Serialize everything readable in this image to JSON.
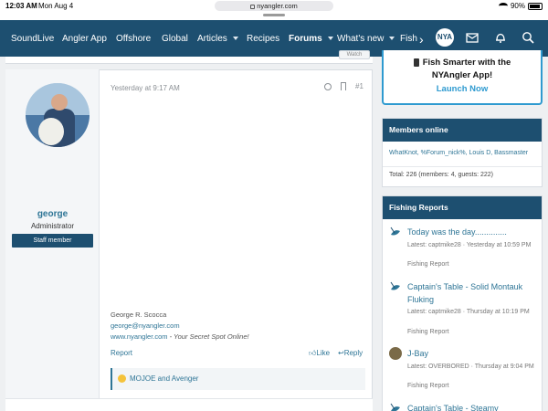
{
  "status_bar": {
    "time": "12:03 AM",
    "date": "Mon Aug 4",
    "url": "nyangler.com",
    "battery": "90%"
  },
  "nav": {
    "items": [
      {
        "label": "SoundLive",
        "caret": false,
        "bold": false
      },
      {
        "label": "Angler App",
        "caret": false,
        "bold": false
      },
      {
        "label": "Offshore",
        "caret": false,
        "bold": false
      },
      {
        "label": "Global",
        "caret": false,
        "bold": false
      },
      {
        "label": "Articles",
        "caret": true,
        "bold": false
      },
      {
        "label": "Recipes",
        "caret": false,
        "bold": false
      },
      {
        "label": "Forums",
        "caret": true,
        "bold": true
      },
      {
        "label": "What's new",
        "caret": true,
        "bold": false
      },
      {
        "label": "Fish",
        "caret": false,
        "bold": false
      }
    ],
    "logo_text": "NYA",
    "icons": [
      "inbox-icon",
      "bell-icon",
      "search-icon"
    ]
  },
  "post": {
    "watch_label": "Watch",
    "author_name": "george",
    "author_role": "Administrator",
    "author_badge": "Staff member",
    "timestamp": "Yesterday at 9:17 AM",
    "post_number": "#1",
    "signature": {
      "name": "George R. Scocca",
      "email": "george@nyangler.com",
      "site": "www.nyangler.com",
      "tagline": " - Your Secret Spot Online!"
    },
    "report_label": "Report",
    "like_label": "Like",
    "reply_label": "Reply",
    "reactions_text": "MOJOE and Avenger"
  },
  "sidebar": {
    "promo": {
      "line1": "Fish Smarter with the",
      "line2": "NYAngler App!",
      "line3": "Launch Now"
    },
    "members_online": {
      "title": "Members online",
      "list": "WhatKnot, %Forum_nick%, Louis D, Bassmaster",
      "total": "Total: 226 (members: 4, guests: 222)"
    },
    "fishing_reports": {
      "title": "Fishing Reports",
      "items": [
        {
          "title": "Today was the day..............",
          "meta": "Latest: captmike28 · Yesterday at 10:59 PM",
          "forum": "Fishing Report"
        },
        {
          "title": "Captain's Table - Solid Montauk Fluking",
          "meta": "Latest: captmike28 · Thursday at 10:19 PM",
          "forum": "Fishing Report"
        },
        {
          "title": "J-Bay",
          "meta": "Latest: OVERBORED · Thursday at 9:04 PM",
          "forum": "Fishing Report"
        },
        {
          "title": "Captain's Table - Steamy",
          "meta": "",
          "forum": ""
        }
      ]
    }
  },
  "colors": {
    "nav_bg": "#1d4f70",
    "link": "#2e7596",
    "promo_accent": "#2e9ad0"
  }
}
